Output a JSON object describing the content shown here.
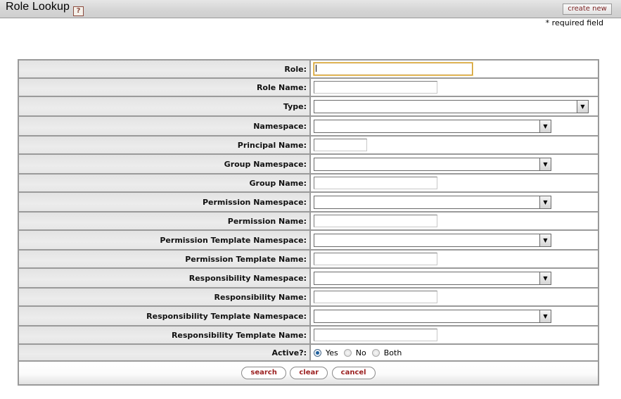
{
  "header": {
    "title": "Role Lookup",
    "help_icon": "help-icon",
    "help_glyph": "?",
    "create_new_label": "create new"
  },
  "required_note": "* required field",
  "form": {
    "fields": [
      {
        "label": "Role:",
        "type": "text",
        "value": "",
        "focused": true
      },
      {
        "label": "Role Name:",
        "type": "text",
        "value": ""
      },
      {
        "label": "Type:",
        "type": "select",
        "value": ""
      },
      {
        "label": "Namespace:",
        "type": "select",
        "value": ""
      },
      {
        "label": "Principal Name:",
        "type": "text",
        "value": ""
      },
      {
        "label": "Group Namespace:",
        "type": "select",
        "value": ""
      },
      {
        "label": "Group Name:",
        "type": "text",
        "value": ""
      },
      {
        "label": "Permission Namespace:",
        "type": "select",
        "value": ""
      },
      {
        "label": "Permission Name:",
        "type": "text",
        "value": ""
      },
      {
        "label": "Permission Template Namespace:",
        "type": "select",
        "value": ""
      },
      {
        "label": "Permission Template Name:",
        "type": "text",
        "value": ""
      },
      {
        "label": "Responsibility Namespace:",
        "type": "select",
        "value": ""
      },
      {
        "label": "Responsibility Name:",
        "type": "text",
        "value": ""
      },
      {
        "label": "Responsibility Template Namespace:",
        "type": "select",
        "value": ""
      },
      {
        "label": "Responsibility Template Name:",
        "type": "text",
        "value": ""
      }
    ],
    "active": {
      "label": "Active?:",
      "options": [
        "Yes",
        "No",
        "Both"
      ],
      "selected": "Yes"
    },
    "dropdown_arrow_glyph": "▼"
  },
  "buttons": {
    "search": "search",
    "clear": "clear",
    "cancel": "cancel"
  }
}
